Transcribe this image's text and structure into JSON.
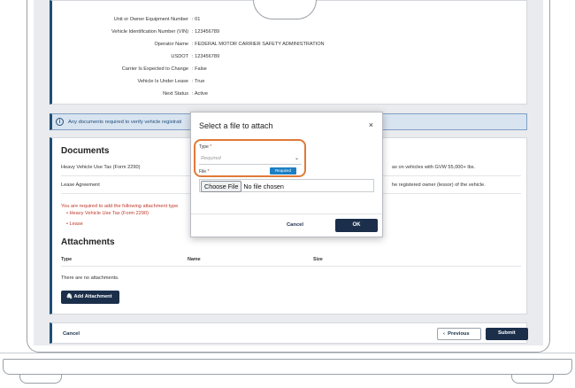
{
  "summary": {
    "rows": [
      {
        "label": "Unit or Owner Equipment Number",
        "value": "01"
      },
      {
        "label": "Vehicle Identification Number (VIN)",
        "value": "123456789"
      },
      {
        "label": "Operator Name",
        "value": "FEDERAL MOTOR CARRIER SAFETY ADMINISTRATION"
      },
      {
        "label": "USDOT",
        "value": "123456789"
      },
      {
        "label": "Carrier Is Expected to Change",
        "value": "False"
      },
      {
        "label": "Vehicle Is Under Lease",
        "value": "True"
      },
      {
        "label": "Next Status",
        "value": "Active"
      }
    ]
  },
  "info_bar": {
    "text": "Any documents required to verify vehicle registrati"
  },
  "documents": {
    "heading": "Documents",
    "rows": [
      {
        "name": "Heavy Vehicle Use Tax (Form 2290)",
        "note": "ax on vehicles with GVW 55,000+ lbs."
      },
      {
        "name": "Lease Agreement",
        "note": "he registered owner (lessor) of the vehicle."
      }
    ],
    "warning": "You are required to add the following attachment type",
    "warning_items": [
      "Heavy Vehicle Use Tax (Form 2290)",
      "Lease"
    ]
  },
  "attachments": {
    "heading": "Attachments",
    "columns": [
      "Type",
      "Name",
      "Size"
    ],
    "empty_text": "There are no attachments.",
    "add_button": "Add Attachment"
  },
  "footer": {
    "cancel": "Cancel",
    "previous": "Previous",
    "submit": "Submit"
  },
  "modal": {
    "title": "Select a file to attach",
    "close": "×",
    "type_label": "Type",
    "type_placeholder": "Required",
    "required_tag": "Required",
    "file_label": "File",
    "choose_file": "Choose File",
    "no_file": "No file chosen",
    "cancel": "Cancel",
    "ok": "OK"
  },
  "colors": {
    "accent": "#1b2f4b",
    "highlight": "#e07a38",
    "warning": "#c0392b",
    "info_bg": "#d9e4f1"
  }
}
